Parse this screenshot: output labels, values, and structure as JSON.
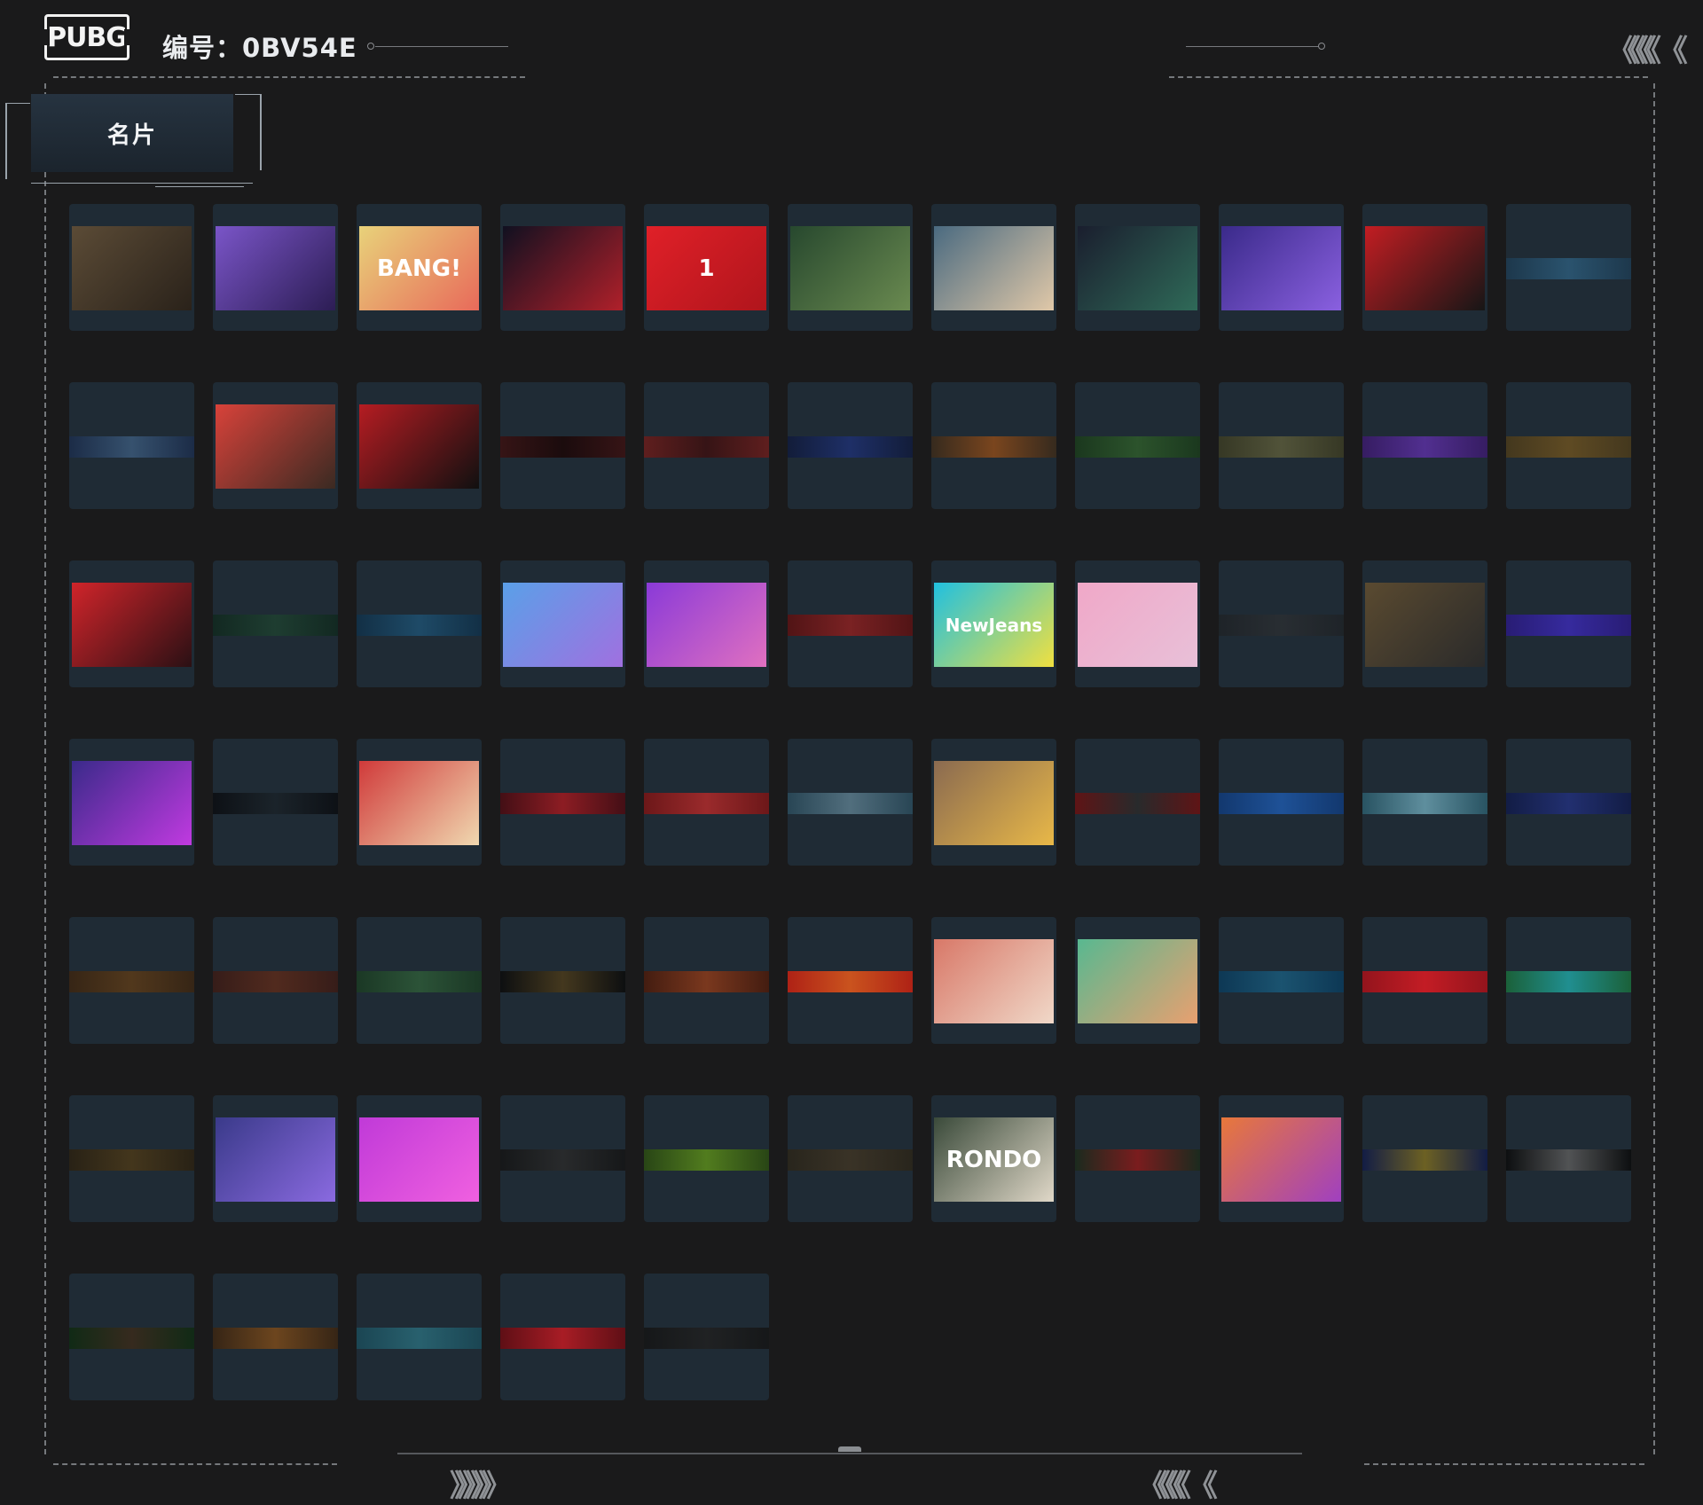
{
  "header": {
    "logo_text": "PUBG",
    "id_label": "编号：0BV54E",
    "arrows_right": "《《《《 《"
  },
  "tab": {
    "label": "名片"
  },
  "footer": {
    "arrows_left": "》》》》》",
    "arrows_right": "《《《《 《"
  },
  "cards": [
    {
      "name": "gears",
      "bg": "#5b4b36",
      "bg2": "#2a221a",
      "locked": false
    },
    {
      "name": "gasmask",
      "bg": "#7a55c8",
      "bg2": "#2c1d54",
      "locked": false
    },
    {
      "name": "bang",
      "bg": "#e8d27a",
      "bg2": "#e86a5a",
      "locked": false,
      "glyph": "BANG!"
    },
    {
      "name": "smile",
      "bg": "#101020",
      "bg2": "#b0202a",
      "locked": false
    },
    {
      "name": "cup1",
      "bg": "#e02028",
      "bg2": "#b0151c",
      "locked": false,
      "glyph": "1"
    },
    {
      "name": "champagne",
      "bg": "#27482e",
      "bg2": "#6a8a50",
      "locked": false
    },
    {
      "name": "snowman",
      "bg": "#4a6a80",
      "bg2": "#e0c8a8",
      "locked": false
    },
    {
      "name": "astronaut",
      "bg": "#1a1e2e",
      "bg2": "#2f6a58",
      "locked": false
    },
    {
      "name": "jet",
      "bg": "#3a2a8a",
      "bg2": "#8a60e0",
      "locked": false
    },
    {
      "name": "wolves",
      "bg": "#c21d22",
      "bg2": "#161616",
      "locked": false
    },
    {
      "name": "blue-dash",
      "bg": "#1d3a50",
      "bg2": "#2c5a78",
      "locked": true
    },
    {
      "name": "moons",
      "bg": "#1b2c4a",
      "bg2": "#3a5878",
      "locked": true
    },
    {
      "name": "warrior",
      "bg": "#d8423a",
      "bg2": "#3a2a22",
      "locked": false
    },
    {
      "name": "goodluck",
      "bg": "#b51c22",
      "bg2": "#101010",
      "locked": false
    },
    {
      "name": "dark-red",
      "bg": "#3a1010",
      "bg2": "#1a0606",
      "locked": true
    },
    {
      "name": "red-cards",
      "bg": "#6a1c1a",
      "bg2": "#3a1010",
      "locked": true
    },
    {
      "name": "navy",
      "bg": "#101a3a",
      "bg2": "#1e3070",
      "locked": true
    },
    {
      "name": "orange-pat",
      "bg": "#3a2a1a",
      "bg2": "#8a4a1a",
      "locked": true
    },
    {
      "name": "green-pat",
      "bg": "#1a3a1a",
      "bg2": "#2e5a2a",
      "locked": true
    },
    {
      "name": "olive-text",
      "bg": "#3a3a22",
      "bg2": "#5a5a3a",
      "locked": true
    },
    {
      "name": "purple-pat",
      "bg": "#3a1a6a",
      "bg2": "#5a30a0",
      "locked": true
    },
    {
      "name": "gold-x",
      "bg": "#4a3a1a",
      "bg2": "#6a5020",
      "locked": true
    },
    {
      "name": "chains",
      "bg": "#d0242a",
      "bg2": "#2a1014",
      "locked": false
    },
    {
      "name": "green-dark",
      "bg": "#10281e",
      "bg2": "#1e4030",
      "locked": true
    },
    {
      "name": "blue-stripe",
      "bg": "#103048",
      "bg2": "#1e5070",
      "locked": true
    },
    {
      "name": "pixel-cat",
      "bg": "#5aa0e8",
      "bg2": "#a070e0",
      "locked": false
    },
    {
      "name": "anime-girl",
      "bg": "#8a3ad8",
      "bg2": "#e070c0",
      "locked": false
    },
    {
      "name": "red-swirl",
      "bg": "#5a1010",
      "bg2": "#8a2020",
      "locked": true
    },
    {
      "name": "newjeans",
      "bg": "#20c0e0",
      "bg2": "#f0e040",
      "locked": false,
      "glyph": "NewJeans"
    },
    {
      "name": "pink-girl",
      "bg": "#f0a8c8",
      "bg2": "#e8c0d8",
      "locked": false
    },
    {
      "name": "dark-gray",
      "bg": "#1e2226",
      "bg2": "#2a2e32",
      "locked": true
    },
    {
      "name": "poster",
      "bg": "#5a4a30",
      "bg2": "#2a2a2a",
      "locked": false
    },
    {
      "name": "indigo",
      "bg": "#2a1a80",
      "bg2": "#3a2ab0",
      "locked": true
    },
    {
      "name": "hacker",
      "bg": "#3a2a8a",
      "bg2": "#c03ae0",
      "locked": false
    },
    {
      "name": "black-vines",
      "bg": "#0a0c10",
      "bg2": "#1a2228",
      "locked": true
    },
    {
      "name": "speakers",
      "bg": "#d03a3a",
      "bg2": "#f0d8b0",
      "locked": false
    },
    {
      "name": "crimson",
      "bg": "#4a0a10",
      "bg2": "#a01a20",
      "locked": true
    },
    {
      "name": "red-paisley",
      "bg": "#7a1414",
      "bg2": "#b02a2a",
      "locked": true
    },
    {
      "name": "mountains",
      "bg": "#2a4a5a",
      "bg2": "#5a7a8a",
      "locked": true
    },
    {
      "name": "chick",
      "bg": "#8a6a50",
      "bg2": "#e8b848",
      "locked": false
    },
    {
      "name": "red-dragon",
      "bg": "#6a1010",
      "bg2": "#2a2a2a",
      "locked": true
    },
    {
      "name": "blue-pattern",
      "bg": "#103a78",
      "bg2": "#1e58a8",
      "locked": true
    },
    {
      "name": "teal-figure",
      "bg": "#2a5a6a",
      "bg2": "#6aa0b0",
      "locked": true
    },
    {
      "name": "blue-paisley",
      "bg": "#101a48",
      "bg2": "#22307a",
      "locked": true
    },
    {
      "name": "brown-pattern",
      "bg": "#3a2410",
      "bg2": "#5a3a18",
      "locked": true
    },
    {
      "name": "rust-pattern",
      "bg": "#3a1a14",
      "bg2": "#5a2a1a",
      "locked": true
    },
    {
      "name": "green-hand",
      "bg": "#1a3a22",
      "bg2": "#2e5a38",
      "locked": true
    },
    {
      "name": "black-gold",
      "bg": "#0a0a0a",
      "bg2": "#4a3a1a",
      "locked": true
    },
    {
      "name": "ember",
      "bg": "#4a1a0a",
      "bg2": "#8a3a1a",
      "locked": true
    },
    {
      "name": "flame-red",
      "bg": "#c82010",
      "bg2": "#e85a1a",
      "locked": true
    },
    {
      "name": "white-dragon",
      "bg": "#d87868",
      "bg2": "#f0d8c8",
      "locked": false
    },
    {
      "name": "two-dragons",
      "bg": "#58b890",
      "bg2": "#e8a070",
      "locked": false
    },
    {
      "name": "ocean",
      "bg": "#0a3a5a",
      "bg2": "#1a5a7a",
      "locked": true
    },
    {
      "name": "red-stripe",
      "bg": "#a81018",
      "bg2": "#e01a22",
      "locked": true
    },
    {
      "name": "aurora",
      "bg": "#1a6a3a",
      "bg2": "#20a0a0",
      "locked": true
    },
    {
      "name": "dark-gold",
      "bg": "#2a2010",
      "bg2": "#4a3818",
      "locked": true
    },
    {
      "name": "crowd",
      "bg": "#3a3a8a",
      "bg2": "#8a6ae0",
      "locked": false
    },
    {
      "name": "dancer",
      "bg": "#c03ad8",
      "bg2": "#f060e0",
      "locked": false
    },
    {
      "name": "feather",
      "bg": "#141414",
      "bg2": "#2a2a2a",
      "locked": true
    },
    {
      "name": "lime",
      "bg": "#2a4a10",
      "bg2": "#5a8a1a",
      "locked": true
    },
    {
      "name": "brown-ornament",
      "bg": "#2a2418",
      "bg2": "#3e3424",
      "locked": true
    },
    {
      "name": "rondo",
      "bg": "#3a4a3a",
      "bg2": "#e0d8c8",
      "locked": false,
      "glyph": "RONDO"
    },
    {
      "name": "shark",
      "bg": "#1a2a1a",
      "bg2": "#8a1a1a",
      "locked": true
    },
    {
      "name": "pumpkin",
      "bg": "#e8783a",
      "bg2": "#a040c0",
      "locked": false
    },
    {
      "name": "navy-gold",
      "bg": "#101a48",
      "bg2": "#7a6a20",
      "locked": true
    },
    {
      "name": "teeth",
      "bg": "#0a0a0a",
      "bg2": "#5a5a5a",
      "locked": true
    },
    {
      "name": "jungle-eye",
      "bg": "#0e2a10",
      "bg2": "#3a2a1a",
      "locked": true
    },
    {
      "name": "bronze",
      "bg": "#3a2410",
      "bg2": "#7a4a1a",
      "locked": true
    },
    {
      "name": "teal",
      "bg": "#1a4a58",
      "bg2": "#2a6a78",
      "locked": true
    },
    {
      "name": "red-tribal",
      "bg": "#6a0a10",
      "bg2": "#c01a22",
      "locked": true
    },
    {
      "name": "charcoal",
      "bg": "#141414",
      "bg2": "#202020",
      "locked": true
    }
  ]
}
